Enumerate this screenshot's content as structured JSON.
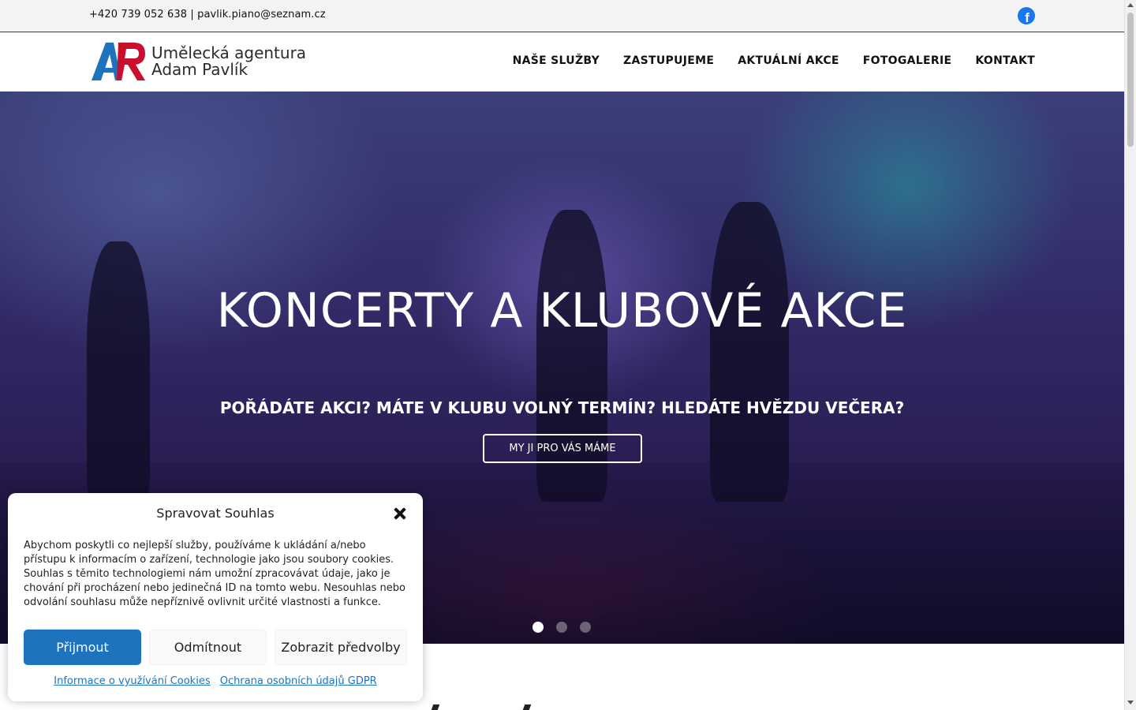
{
  "topbar": {
    "contact": "+420 739 052 638 | pavlik.piano@seznam.cz",
    "social_icon": "facebook-icon"
  },
  "header": {
    "logo_line1": "Umělecká agentura",
    "logo_line2": "Adam Pavlík",
    "nav": [
      "NAŠE SLUŽBY",
      "ZASTUPUJEME",
      "AKTUÁLNÍ AKCE",
      "FOTOGALERIE",
      "KONTAKT"
    ]
  },
  "hero": {
    "title": "KONCERTY A KLUBOVÉ AKCE",
    "subtitle": "POŘÁDÁTE AKCI? MÁTE V KLUBU VOLNÝ TERMÍN? HLEDÁTE HVĚZDU VEČERA?",
    "button": "MY JI PRO VÁS MÁME",
    "slide_count": 3,
    "active_slide": 1
  },
  "cookie": {
    "title": "Spravovat Souhlas",
    "body": "Abychom poskytli co nejlepší služby, používáme k ukládání a/nebo přístupu k informacím o zařízení, technologie jako jsou soubory cookies. Souhlas s těmito technologiemi nám umožní zpracovávat údaje, jako je chování při procházení nebo jedinečná ID na tomto webu. Nesouhlas nebo odvolání souhlasu může nepříznivě ovlivnit určité vlastnosti a funkce.",
    "accept": "Přijmout",
    "deny": "Odmítnout",
    "prefs": "Zobrazit předvolby",
    "link_cookies": "Informace o využívání Cookies",
    "link_gdpr": "Ochrana osobních údajů GDPR"
  },
  "colors": {
    "accent": "#1e73be",
    "facebook": "#1877f2",
    "logo_blue": "#1e73be",
    "logo_red": "#c8102e"
  }
}
